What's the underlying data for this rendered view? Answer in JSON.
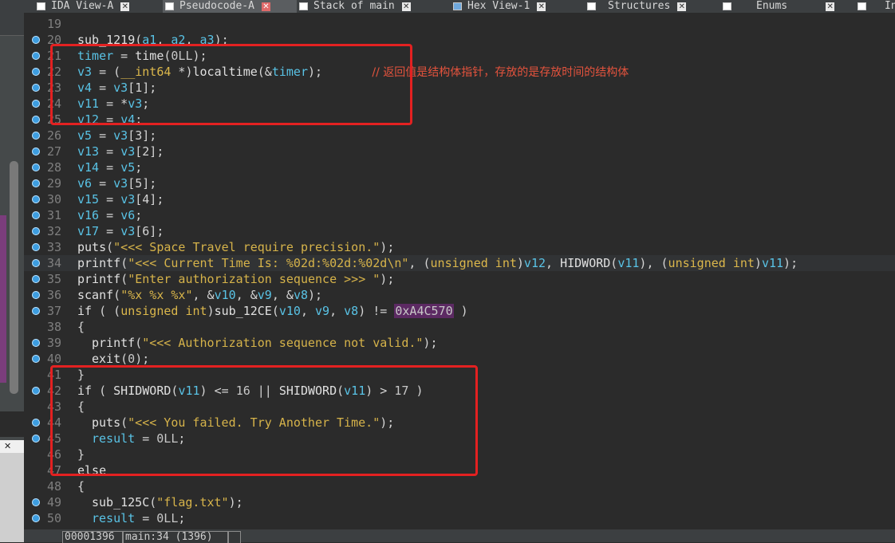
{
  "tabs": [
    {
      "label": "IDA View-A",
      "active": false,
      "icon": "ida-view-icon"
    },
    {
      "label": "Pseudocode-A",
      "active": true,
      "icon": "pseudocode-icon"
    },
    {
      "label": "Stack of main",
      "active": false,
      "icon": "stack-icon"
    },
    {
      "label": "Hex View-1",
      "active": false,
      "icon": "hex-view-icon"
    },
    {
      "label": "Structures",
      "active": false,
      "icon": "structures-icon"
    },
    {
      "label": "Enums",
      "active": false,
      "icon": "enums-icon"
    },
    {
      "label": "In",
      "active": false,
      "icon": "imports-icon"
    }
  ],
  "left_panel": {
    "close_glyph": "✕"
  },
  "code": {
    "lines": [
      {
        "n": "19",
        "bp": false,
        "tokens": []
      },
      {
        "n": "20",
        "bp": true,
        "tokens": [
          [
            "sub_1219",
            "fn"
          ],
          [
            "(",
            ""
          ],
          [
            "a1",
            "var"
          ],
          [
            ", ",
            ""
          ],
          [
            "a2",
            "var"
          ],
          [
            ", ",
            ""
          ],
          [
            "a3",
            "var"
          ],
          [
            ");",
            ""
          ]
        ]
      },
      {
        "n": "21",
        "bp": true,
        "tokens": [
          [
            "timer",
            "var"
          ],
          [
            " = ",
            ""
          ],
          [
            "time",
            "fn"
          ],
          [
            "(",
            ""
          ],
          [
            "0LL",
            "num"
          ],
          [
            ");",
            ""
          ]
        ]
      },
      {
        "n": "22",
        "bp": true,
        "tokens": [
          [
            "v3",
            "var"
          ],
          [
            " = (",
            ""
          ],
          [
            "__int64",
            "type"
          ],
          [
            " *)",
            ""
          ],
          [
            "localtime",
            "fn"
          ],
          [
            "(&",
            ""
          ],
          [
            "timer",
            "var"
          ],
          [
            ");",
            ""
          ],
          [
            "              // 返回值是结构体指针，存放的是存放时间的结构体",
            "cm"
          ]
        ]
      },
      {
        "n": "23",
        "bp": true,
        "tokens": [
          [
            "v4",
            "var"
          ],
          [
            " = ",
            ""
          ],
          [
            "v3",
            "var"
          ],
          [
            "[1];",
            ""
          ]
        ]
      },
      {
        "n": "24",
        "bp": true,
        "tokens": [
          [
            "v11",
            "var"
          ],
          [
            " = *",
            ""
          ],
          [
            "v3",
            "var"
          ],
          [
            ";",
            ""
          ]
        ]
      },
      {
        "n": "25",
        "bp": true,
        "tokens": [
          [
            "v12",
            "var"
          ],
          [
            " = ",
            ""
          ],
          [
            "v4",
            "var"
          ],
          [
            ";",
            ""
          ]
        ]
      },
      {
        "n": "26",
        "bp": true,
        "tokens": [
          [
            "v5",
            "var"
          ],
          [
            " = ",
            ""
          ],
          [
            "v3",
            "var"
          ],
          [
            "[3];",
            ""
          ]
        ]
      },
      {
        "n": "27",
        "bp": true,
        "tokens": [
          [
            "v13",
            "var"
          ],
          [
            " = ",
            ""
          ],
          [
            "v3",
            "var"
          ],
          [
            "[2];",
            ""
          ]
        ]
      },
      {
        "n": "28",
        "bp": true,
        "tokens": [
          [
            "v14",
            "var"
          ],
          [
            " = ",
            ""
          ],
          [
            "v5",
            "var"
          ],
          [
            ";",
            ""
          ]
        ]
      },
      {
        "n": "29",
        "bp": true,
        "tokens": [
          [
            "v6",
            "var"
          ],
          [
            " = ",
            ""
          ],
          [
            "v3",
            "var"
          ],
          [
            "[5];",
            ""
          ]
        ]
      },
      {
        "n": "30",
        "bp": true,
        "tokens": [
          [
            "v15",
            "var"
          ],
          [
            " = ",
            ""
          ],
          [
            "v3",
            "var"
          ],
          [
            "[4];",
            ""
          ]
        ]
      },
      {
        "n": "31",
        "bp": true,
        "tokens": [
          [
            "v16",
            "var"
          ],
          [
            " = ",
            ""
          ],
          [
            "v6",
            "var"
          ],
          [
            ";",
            ""
          ]
        ]
      },
      {
        "n": "32",
        "bp": true,
        "tokens": [
          [
            "v17",
            "var"
          ],
          [
            " = ",
            ""
          ],
          [
            "v3",
            "var"
          ],
          [
            "[6];",
            ""
          ]
        ]
      },
      {
        "n": "33",
        "bp": true,
        "tokens": [
          [
            "puts",
            "fn"
          ],
          [
            "(",
            ""
          ],
          [
            "\"<<< Space Travel require precision.\"",
            "str"
          ],
          [
            ");",
            ""
          ]
        ]
      },
      {
        "n": "34",
        "bp": true,
        "hl": true,
        "tokens": [
          [
            "printf",
            "fn"
          ],
          [
            "(",
            ""
          ],
          [
            "\"<<< Current Time Is: %02d:%02d:%02d\\n\"",
            "str"
          ],
          [
            ", (",
            ""
          ],
          [
            "unsigned int",
            "type"
          ],
          [
            ")",
            ""
          ],
          [
            "v12",
            "var"
          ],
          [
            ", ",
            ""
          ],
          [
            "HIDWORD",
            "fn"
          ],
          [
            "(",
            ""
          ],
          [
            "v11",
            "var"
          ],
          [
            "), (",
            ""
          ],
          [
            "unsigned int",
            "type"
          ],
          [
            ")",
            ""
          ],
          [
            "v11",
            "var"
          ],
          [
            ");",
            ""
          ]
        ]
      },
      {
        "n": "35",
        "bp": true,
        "tokens": [
          [
            "printf",
            "fn"
          ],
          [
            "(",
            ""
          ],
          [
            "\"Enter authorization sequence >>> \"",
            "str"
          ],
          [
            ");",
            ""
          ]
        ]
      },
      {
        "n": "36",
        "bp": true,
        "tokens": [
          [
            "scanf",
            "fn"
          ],
          [
            "(",
            ""
          ],
          [
            "\"%x %x %x\"",
            "str"
          ],
          [
            ", &",
            ""
          ],
          [
            "v10",
            "var"
          ],
          [
            ", &",
            ""
          ],
          [
            "v9",
            "var"
          ],
          [
            ", &",
            ""
          ],
          [
            "v8",
            "var"
          ],
          [
            ");",
            ""
          ]
        ]
      },
      {
        "n": "37",
        "bp": true,
        "tokens": [
          [
            "if",
            "kw"
          ],
          [
            " ( (",
            ""
          ],
          [
            "unsigned int",
            "type"
          ],
          [
            ")",
            ""
          ],
          [
            "sub_12CE",
            "fn"
          ],
          [
            "(",
            ""
          ],
          [
            "v10",
            "var"
          ],
          [
            ", ",
            ""
          ],
          [
            "v9",
            "var"
          ],
          [
            ", ",
            ""
          ],
          [
            "v8",
            "var"
          ],
          [
            ") != ",
            ""
          ],
          [
            "0xA4C570",
            "hex"
          ],
          [
            " )",
            ""
          ]
        ]
      },
      {
        "n": "38",
        "bp": false,
        "tokens": [
          [
            "{",
            ""
          ]
        ]
      },
      {
        "n": "39",
        "bp": true,
        "indent": 1,
        "tokens": [
          [
            "printf",
            "fn"
          ],
          [
            "(",
            ""
          ],
          [
            "\"<<< Authorization sequence not valid.\"",
            "str"
          ],
          [
            ");",
            ""
          ]
        ]
      },
      {
        "n": "40",
        "bp": true,
        "indent": 1,
        "tokens": [
          [
            "exit",
            "fn"
          ],
          [
            "(",
            ""
          ],
          [
            "0",
            "num"
          ],
          [
            ");",
            ""
          ]
        ]
      },
      {
        "n": "41",
        "bp": false,
        "tokens": [
          [
            "}",
            ""
          ]
        ]
      },
      {
        "n": "42",
        "bp": true,
        "tokens": [
          [
            "if",
            "kw"
          ],
          [
            " ( ",
            ""
          ],
          [
            "SHIDWORD",
            "fn"
          ],
          [
            "(",
            ""
          ],
          [
            "v11",
            "var"
          ],
          [
            ") <= ",
            ""
          ],
          [
            "16",
            "num"
          ],
          [
            " || ",
            ""
          ],
          [
            "SHIDWORD",
            "fn"
          ],
          [
            "(",
            ""
          ],
          [
            "v11",
            "var"
          ],
          [
            ") > ",
            ""
          ],
          [
            "17",
            "num"
          ],
          [
            " )",
            ""
          ]
        ]
      },
      {
        "n": "43",
        "bp": false,
        "tokens": [
          [
            "{",
            ""
          ]
        ]
      },
      {
        "n": "44",
        "bp": true,
        "indent": 1,
        "tokens": [
          [
            "puts",
            "fn"
          ],
          [
            "(",
            ""
          ],
          [
            "\"<<< You failed. Try Another Time.\"",
            "str"
          ],
          [
            ");",
            ""
          ]
        ]
      },
      {
        "n": "45",
        "bp": true,
        "indent": 1,
        "tokens": [
          [
            "result",
            "var"
          ],
          [
            " = ",
            ""
          ],
          [
            "0LL",
            "num"
          ],
          [
            ";",
            ""
          ]
        ]
      },
      {
        "n": "46",
        "bp": false,
        "tokens": [
          [
            "}",
            ""
          ]
        ]
      },
      {
        "n": "47",
        "bp": false,
        "tokens": [
          [
            "else",
            "kw"
          ]
        ]
      },
      {
        "n": "48",
        "bp": false,
        "tokens": [
          [
            "{",
            ""
          ]
        ]
      },
      {
        "n": "49",
        "bp": true,
        "indent": 1,
        "tokens": [
          [
            "sub_125C",
            "fn"
          ],
          [
            "(",
            ""
          ],
          [
            "\"flag.txt\"",
            "str"
          ],
          [
            ");",
            ""
          ]
        ]
      },
      {
        "n": "50",
        "bp": true,
        "indent": 1,
        "tokens": [
          [
            "result",
            "var"
          ],
          [
            " = ",
            ""
          ],
          [
            "0LL",
            "num"
          ],
          [
            ";",
            ""
          ]
        ]
      }
    ]
  },
  "status": {
    "address": "00001396",
    "location": "main:34 (1396)"
  }
}
